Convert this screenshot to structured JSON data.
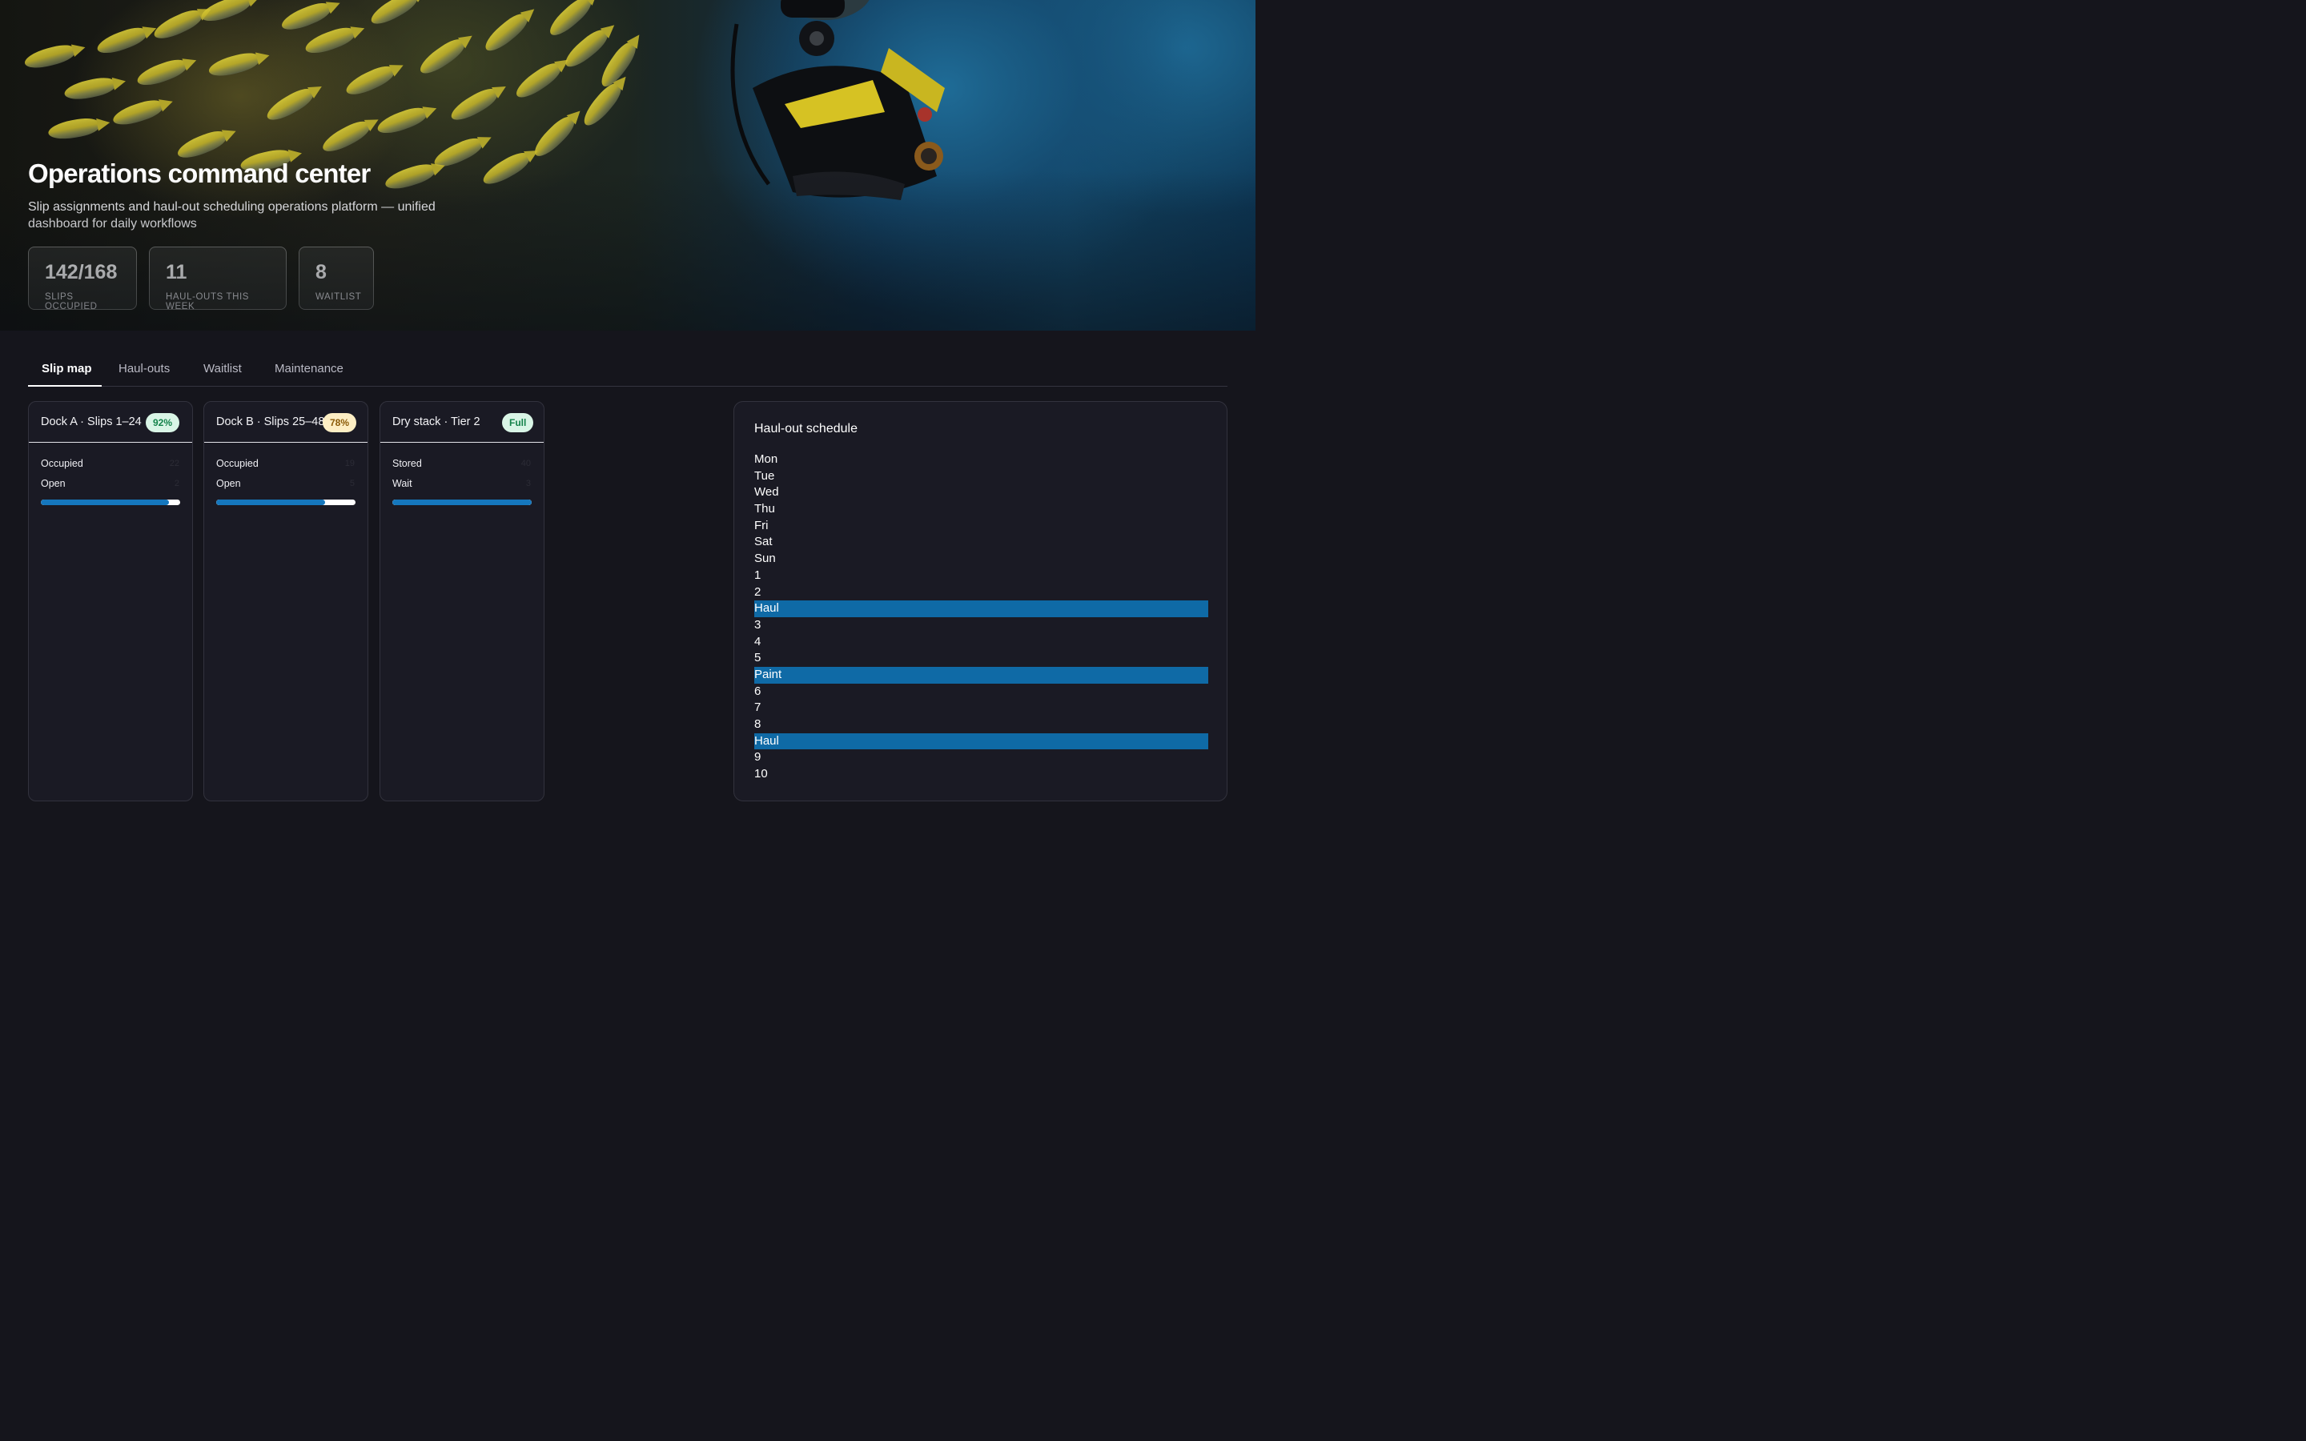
{
  "hero": {
    "title": "Operations command center",
    "subtitle": "Slip assignments and haul-out scheduling operations platform — unified dashboard for daily workflows",
    "stats": [
      {
        "value": "142/168",
        "label": "SLIPS OCCUPIED"
      },
      {
        "value": "11",
        "label": "HAUL-OUTS THIS WEEK"
      },
      {
        "value": "8",
        "label": "WAITLIST"
      }
    ]
  },
  "tabs": [
    {
      "label": "Slip map",
      "active": true
    },
    {
      "label": "Haul-outs",
      "active": false
    },
    {
      "label": "Waitlist",
      "active": false
    },
    {
      "label": "Maintenance",
      "active": false
    }
  ],
  "docks": [
    {
      "title": "Dock A · Slips 1–24",
      "badge": "92%",
      "badge_color": "#d9f5e6",
      "rows": [
        {
          "label": "Occupied",
          "value": "22"
        },
        {
          "label": "Open",
          "value": "2"
        }
      ],
      "fill": 0.92
    },
    {
      "title": "Dock B · Slips 25–48",
      "badge": "78%",
      "badge_color": "#fdeec4",
      "rows": [
        {
          "label": "Occupied",
          "value": "19"
        },
        {
          "label": "Open",
          "value": "5"
        }
      ],
      "fill": 0.78
    },
    {
      "title": "Dry stack · Tier 2",
      "badge": "Full",
      "badge_color": "#d9f5e6",
      "rows": [
        {
          "label": "Stored",
          "value": "40"
        },
        {
          "label": "Wait",
          "value": "3"
        }
      ],
      "fill": 1.0
    }
  ],
  "schedule": {
    "title": "Haul-out schedule",
    "entries": [
      "Mon",
      "Tue",
      "Wed",
      "Thu",
      "Fri",
      "Sat",
      "Sun",
      "1",
      "2",
      "Haul",
      "3",
      "4",
      "5",
      "Paint",
      "6",
      "7",
      "8",
      "Haul",
      "9",
      "10"
    ],
    "highlighted": [
      "Haul",
      "Paint"
    ]
  },
  "colors": {
    "accent": "#1577bd",
    "background": "#15151c",
    "card": "#1a1a24"
  }
}
